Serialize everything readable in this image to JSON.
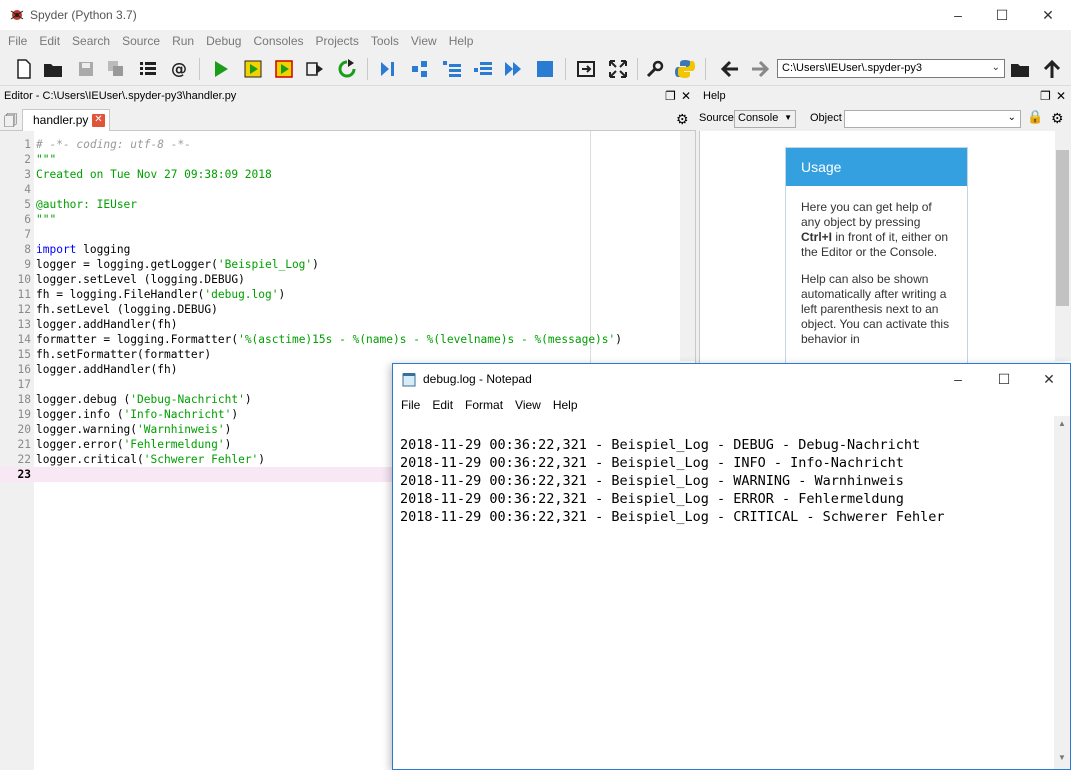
{
  "spyder": {
    "window_title": "Spyder (Python 3.7)",
    "menu": [
      "File",
      "Edit",
      "Search",
      "Source",
      "Run",
      "Debug",
      "Consoles",
      "Projects",
      "Tools",
      "View",
      "Help"
    ],
    "working_dir": "C:\\Users\\IEUser\\.spyder-py3"
  },
  "editor": {
    "pane_title": "Editor - C:\\Users\\IEUser\\.spyder-py3\\handler.py",
    "tab_label": "handler.py",
    "current_line": 23,
    "lines": [
      [
        [
          "c-comment",
          "# -*- coding: utf-8 -*-"
        ]
      ],
      [
        [
          "c-str",
          "\"\"\""
        ]
      ],
      [
        [
          "c-str",
          "Created on Tue Nov 27 09:38:09 2018"
        ]
      ],
      [
        [
          "c-plain",
          ""
        ]
      ],
      [
        [
          "c-str",
          "@author: IEUser"
        ]
      ],
      [
        [
          "c-str",
          "\"\"\""
        ]
      ],
      [
        [
          "c-plain",
          ""
        ]
      ],
      [
        [
          "c-kw",
          "import"
        ],
        [
          "c-plain",
          " logging"
        ]
      ],
      [
        [
          "c-plain",
          "logger = logging.getLogger("
        ],
        [
          "c-str",
          "'Beispiel_Log'"
        ],
        [
          "c-plain",
          ")"
        ]
      ],
      [
        [
          "c-plain",
          "logger.setLevel (logging.DEBUG)"
        ]
      ],
      [
        [
          "c-plain",
          "fh = logging.FileHandler("
        ],
        [
          "c-str",
          "'debug.log'"
        ],
        [
          "c-plain",
          ")"
        ]
      ],
      [
        [
          "c-plain",
          "fh.setLevel (logging.DEBUG)"
        ]
      ],
      [
        [
          "c-plain",
          "logger.addHandler(fh)"
        ]
      ],
      [
        [
          "c-plain",
          "formatter = logging.Formatter("
        ],
        [
          "c-str",
          "'%(asctime)15s - %(name)s - %(levelname)s - %(message)s'"
        ],
        [
          "c-plain",
          ")"
        ]
      ],
      [
        [
          "c-plain",
          "fh.setFormatter(formatter)"
        ]
      ],
      [
        [
          "c-plain",
          "logger.addHandler(fh)"
        ]
      ],
      [
        [
          "c-plain",
          ""
        ]
      ],
      [
        [
          "c-plain",
          "logger.debug ("
        ],
        [
          "c-str",
          "'Debug-Nachricht'"
        ],
        [
          "c-plain",
          ")"
        ]
      ],
      [
        [
          "c-plain",
          "logger.info ("
        ],
        [
          "c-str",
          "'Info-Nachricht'"
        ],
        [
          "c-plain",
          ")"
        ]
      ],
      [
        [
          "c-plain",
          "logger.warning("
        ],
        [
          "c-str",
          "'Warnhinweis'"
        ],
        [
          "c-plain",
          ")"
        ]
      ],
      [
        [
          "c-plain",
          "logger.error("
        ],
        [
          "c-str",
          "'Fehlermeldung'"
        ],
        [
          "c-plain",
          ")"
        ]
      ],
      [
        [
          "c-plain",
          "logger.critical("
        ],
        [
          "c-str",
          "'Schwerer Fehler'"
        ],
        [
          "c-plain",
          ")"
        ]
      ],
      [
        [
          "c-plain",
          ""
        ]
      ]
    ]
  },
  "help": {
    "pane_title": "Help",
    "source_label": "Source",
    "source_value": "Console",
    "object_label": "Object",
    "usage_title": "Usage",
    "usage_p1_a": "Here you can get help of any object by pressing ",
    "usage_p1_key": "Ctrl+I",
    "usage_p1_b": " in front of it, either on the Editor or the Console.",
    "usage_p2": "Help can also be shown automatically after writing a left parenthesis next to an object. You can activate this behavior in"
  },
  "notepad": {
    "window_title": "debug.log - Notepad",
    "menu": [
      "File",
      "Edit",
      "Format",
      "View",
      "Help"
    ],
    "lines": [
      "",
      "2018-11-29 00:36:22,321 - Beispiel_Log - DEBUG - Debug-Nachricht",
      "2018-11-29 00:36:22,321 - Beispiel_Log - INFO - Info-Nachricht",
      "2018-11-29 00:36:22,321 - Beispiel_Log - WARNING - Warnhinweis",
      "2018-11-29 00:36:22,321 - Beispiel_Log - ERROR - Fehlermeldung",
      "2018-11-29 00:36:22,321 - Beispiel_Log - CRITICAL - Schwerer Fehler"
    ]
  },
  "colors": {
    "run_green": "#1a9e1a",
    "debug_blue": "#2a7bd4",
    "usage_header": "#34a0e0",
    "string_green": "#00a000",
    "keyword_blue": "#0000ff"
  }
}
